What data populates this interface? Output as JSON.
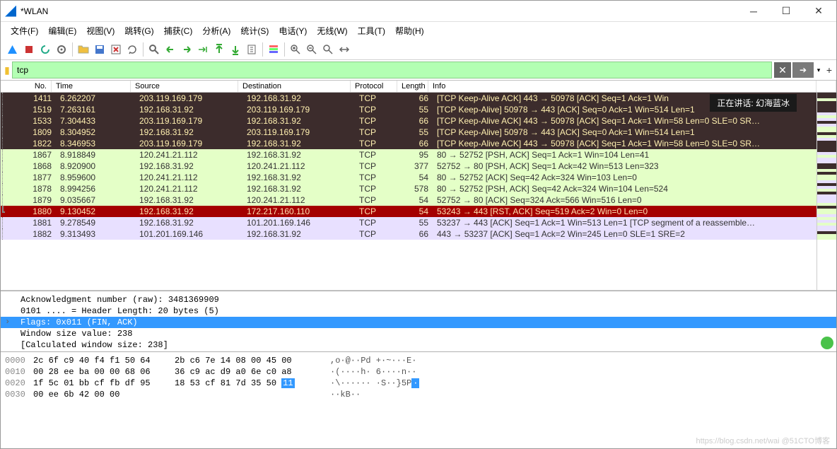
{
  "window_title": "*WLAN",
  "menu": [
    "文件(F)",
    "编辑(E)",
    "视图(V)",
    "跳转(G)",
    "捕获(C)",
    "分析(A)",
    "统计(S)",
    "电话(Y)",
    "无线(W)",
    "工具(T)",
    "帮助(H)"
  ],
  "filter_value": "tcp",
  "tooltip": "正在讲话: 幻海蓝冰",
  "columns": {
    "no": "No.",
    "time": "Time",
    "src": "Source",
    "dst": "Destination",
    "proto": "Protocol",
    "len": "Length",
    "info": "Info"
  },
  "packets": [
    {
      "no": "1411",
      "time": "6.262207",
      "src": "203.119.169.179",
      "dst": "192.168.31.92",
      "proto": "TCP",
      "len": "66",
      "info": "[TCP Keep-Alive ACK] 443 → 50978 [ACK] Seq=1 Ack=1 Win",
      "theme": "dark"
    },
    {
      "no": "1519",
      "time": "7.263161",
      "src": "192.168.31.92",
      "dst": "203.119.169.179",
      "proto": "TCP",
      "len": "55",
      "info": "[TCP Keep-Alive] 50978 → 443 [ACK] Seq=0 Ack=1 Win=514 Len=1",
      "theme": "dark"
    },
    {
      "no": "1533",
      "time": "7.304433",
      "src": "203.119.169.179",
      "dst": "192.168.31.92",
      "proto": "TCP",
      "len": "66",
      "info": "[TCP Keep-Alive ACK] 443 → 50978 [ACK] Seq=1 Ack=1 Win=58 Len=0 SLE=0 SR…",
      "theme": "dark"
    },
    {
      "no": "1809",
      "time": "8.304952",
      "src": "192.168.31.92",
      "dst": "203.119.169.179",
      "proto": "TCP",
      "len": "55",
      "info": "[TCP Keep-Alive] 50978 → 443 [ACK] Seq=0 Ack=1 Win=514 Len=1",
      "theme": "dark"
    },
    {
      "no": "1822",
      "time": "8.346953",
      "src": "203.119.169.179",
      "dst": "192.168.31.92",
      "proto": "TCP",
      "len": "66",
      "info": "[TCP Keep-Alive ACK] 443 → 50978 [ACK] Seq=1 Ack=1 Win=58 Len=0 SLE=0 SR…",
      "theme": "dark"
    },
    {
      "no": "1867",
      "time": "8.918849",
      "src": "120.241.21.112",
      "dst": "192.168.31.92",
      "proto": "TCP",
      "len": "95",
      "info": "80 → 52752 [PSH, ACK] Seq=1 Ack=1 Win=104 Len=41",
      "theme": "green"
    },
    {
      "no": "1868",
      "time": "8.920900",
      "src": "192.168.31.92",
      "dst": "120.241.21.112",
      "proto": "TCP",
      "len": "377",
      "info": "52752 → 80 [PSH, ACK] Seq=1 Ack=42 Win=513 Len=323",
      "theme": "green"
    },
    {
      "no": "1877",
      "time": "8.959600",
      "src": "120.241.21.112",
      "dst": "192.168.31.92",
      "proto": "TCP",
      "len": "54",
      "info": "80 → 52752 [ACK] Seq=42 Ack=324 Win=103 Len=0",
      "theme": "green"
    },
    {
      "no": "1878",
      "time": "8.994256",
      "src": "120.241.21.112",
      "dst": "192.168.31.92",
      "proto": "TCP",
      "len": "578",
      "info": "80 → 52752 [PSH, ACK] Seq=42 Ack=324 Win=104 Len=524",
      "theme": "green"
    },
    {
      "no": "1879",
      "time": "9.035667",
      "src": "192.168.31.92",
      "dst": "120.241.21.112",
      "proto": "TCP",
      "len": "54",
      "info": "52752 → 80 [ACK] Seq=324 Ack=566 Win=516 Len=0",
      "theme": "green"
    },
    {
      "no": "1880",
      "time": "9.130452",
      "src": "192.168.31.92",
      "dst": "172.217.160.110",
      "proto": "TCP",
      "len": "54",
      "info": "53243 → 443 [RST, ACK] Seq=519 Ack=2 Win=0 Len=0",
      "theme": "red",
      "bracket": "end"
    },
    {
      "no": "1881",
      "time": "9.278549",
      "src": "192.168.31.92",
      "dst": "101.201.169.146",
      "proto": "TCP",
      "len": "55",
      "info": "53237 → 443 [ACK] Seq=1 Ack=1 Win=513 Len=1 [TCP segment of a reassemble…",
      "theme": "lav"
    },
    {
      "no": "1882",
      "time": "9.313493",
      "src": "101.201.169.146",
      "dst": "192.168.31.92",
      "proto": "TCP",
      "len": "66",
      "info": "443 → 53237 [ACK] Seq=1 Ack=2 Win=245 Len=0 SLE=1 SRE=2",
      "theme": "lav"
    }
  ],
  "details": {
    "ack_raw": "Acknowledgment number (raw): 3481369909",
    "hdr_len": "0101 .... = Header Length: 20 bytes (5)",
    "flags": "Flags: 0x011 (FIN, ACK)",
    "win_val": "Window size value: 238",
    "calc_win": "[Calculated window size: 238]"
  },
  "bytes": [
    {
      "off": "0000",
      "h1": "2c 6f c9 40 f4 f1 50 64",
      "h2": "2b c6 7e 14 08 00 45 00",
      "ascii": ",o·@··Pd +·~···E·"
    },
    {
      "off": "0010",
      "h1": "00 28 ee ba 00 00 68 06",
      "h2": "36 c9 ac d9 a0 6e c0 a8",
      "ascii": "·(····h· 6····n··"
    },
    {
      "off": "0020",
      "h1": "1f 5c 01 bb cf fb df 95",
      "h2": "18 53 cf 81 7d 35 50 ",
      "h2_hl": "11",
      "ascii": "·\\······ ·S··}5P",
      "ascii_hl": "·"
    },
    {
      "off": "0030",
      "h1": "00 ee 6b 42 00 00",
      "h2": "",
      "ascii": "··kB··"
    }
  ],
  "watermark": "https://blog.csdn.net/wai @51CTO博客"
}
